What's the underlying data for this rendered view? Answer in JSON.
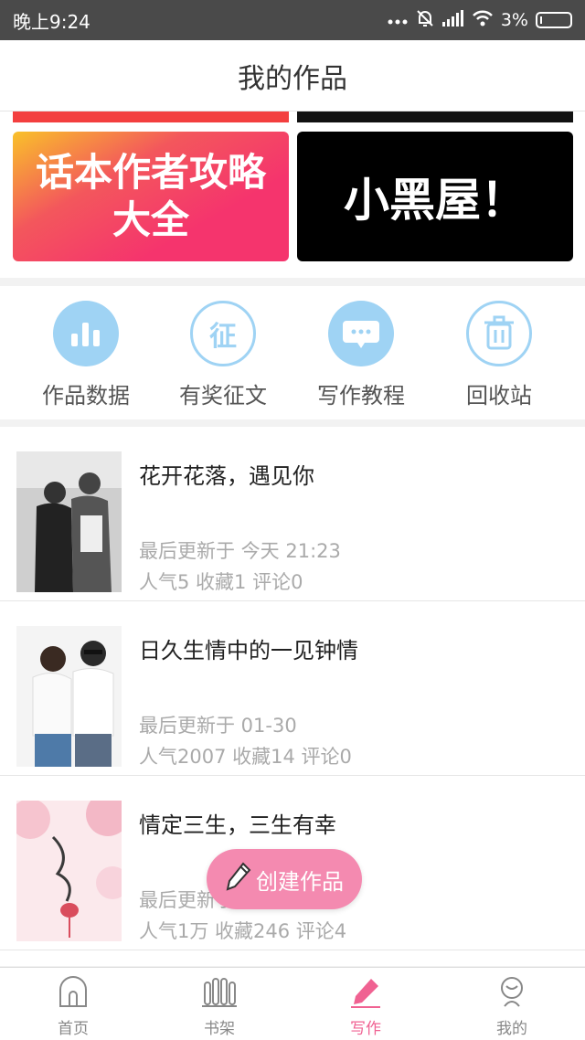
{
  "status_bar": {
    "time": "晚上9:24",
    "battery": "3%"
  },
  "header": {
    "title": "我的作品"
  },
  "banners": [
    {
      "text_line1": "话本作者攻略",
      "text_line2": "大全",
      "bg_color": "#f5346d"
    },
    {
      "text": "小黑屋！",
      "bg_color": "#000000"
    }
  ],
  "quick_actions": [
    {
      "label": "作品数据",
      "icon": "bar-chart-icon"
    },
    {
      "label": "有奖征文",
      "icon": "zheng-badge-icon",
      "glyph": "征"
    },
    {
      "label": "写作教程",
      "icon": "chat-bubble-icon"
    },
    {
      "label": "回收站",
      "icon": "trash-icon"
    }
  ],
  "works": [
    {
      "title": "花开花落，遇见你",
      "updated": "最后更新于 今天 21:23",
      "stats": "人气5 收藏1 评论0"
    },
    {
      "title": "日久生情中的一见钟情",
      "updated": "最后更新于 01-30",
      "stats": "人气2007 收藏14 评论0"
    },
    {
      "title": "情定三生，三生有幸",
      "updated": "最后更新于",
      "stats": "人气1万 收藏246 评论4"
    }
  ],
  "fab": {
    "label": "创建作品"
  },
  "bottom_nav": [
    {
      "label": "首页",
      "icon": "home-icon"
    },
    {
      "label": "书架",
      "icon": "bookshelf-icon"
    },
    {
      "label": "写作",
      "icon": "pen-icon",
      "active": true
    },
    {
      "label": "我的",
      "icon": "profile-icon"
    }
  ],
  "colors": {
    "accent": "#f06292",
    "icon_blue": "#9fd3f4"
  }
}
